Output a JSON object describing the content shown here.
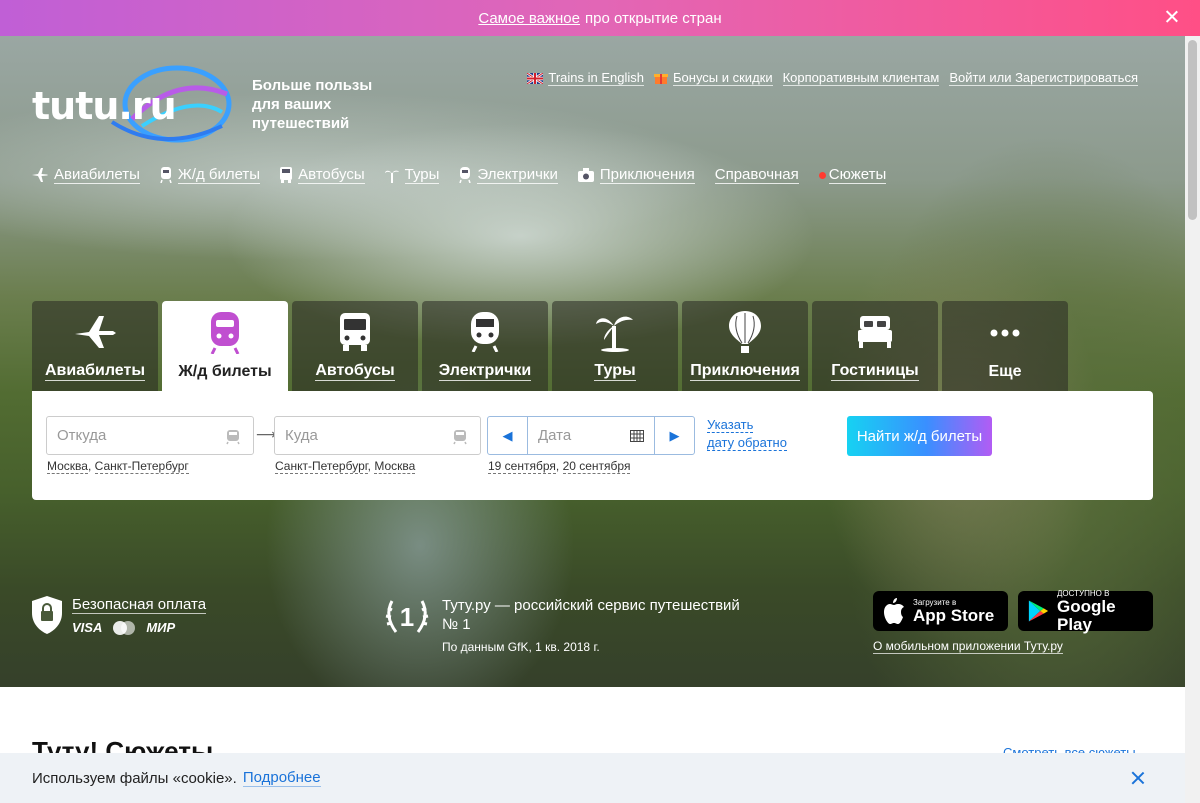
{
  "promo": {
    "link": "Самое важное",
    "text": "про открытие стран"
  },
  "logo": {
    "text": "tutu.ru"
  },
  "tagline": "Больше пользы для ваших путешествий",
  "toplinks": [
    {
      "label": "Trains in English",
      "icon": "uk-flag-icon"
    },
    {
      "label": "Бонусы и скидки",
      "icon": "gift-icon"
    },
    {
      "label": "Корпоративным клиентам"
    },
    {
      "label": "Войти или Зарегистрироваться"
    }
  ],
  "mainnav": [
    {
      "label": "Авиабилеты",
      "icon": "plane-icon"
    },
    {
      "label": "Ж/д билеты",
      "icon": "train-icon"
    },
    {
      "label": "Автобусы",
      "icon": "bus-icon"
    },
    {
      "label": "Туры",
      "icon": "palm-icon"
    },
    {
      "label": "Электрички",
      "icon": "suburban-train-icon"
    },
    {
      "label": "Приключения",
      "icon": "camera-icon"
    },
    {
      "label": "Справочная"
    },
    {
      "label": "Сюжеты",
      "icon": "red-dot-icon"
    }
  ],
  "tabs": [
    {
      "label": "Авиабилеты",
      "icon": "plane-icon"
    },
    {
      "label": "Ж/д билеты",
      "icon": "train-icon",
      "active": true
    },
    {
      "label": "Автобусы",
      "icon": "bus-icon"
    },
    {
      "label": "Электрички",
      "icon": "suburban-train-icon"
    },
    {
      "label": "Туры",
      "icon": "palm-icon"
    },
    {
      "label": "Приключения",
      "icon": "balloon-icon"
    },
    {
      "label": "Гостиницы",
      "icon": "bed-icon"
    },
    {
      "label": "Еще",
      "icon": "more-icon"
    }
  ],
  "search": {
    "from_placeholder": "Откуда",
    "to_placeholder": "Куда",
    "date_placeholder": "Дата",
    "from_hints": [
      "Москва",
      "Санкт-Петербург"
    ],
    "to_hints": [
      "Санкт-Петербург",
      "Москва"
    ],
    "date_hints": [
      "19 сентября",
      "20 сентября"
    ],
    "back_date": "Указать датy обратно",
    "back_date_l1": "Указать",
    "back_date_l2": "дату обратно",
    "find_button": "Найти ж/д билеты"
  },
  "secure": {
    "title": "Безопасная оплата",
    "cards": [
      "VISA",
      "MasterCard",
      "МИР"
    ]
  },
  "award": {
    "line1": "Туту.ру — российский сервис путешествий",
    "line2": "№ 1",
    "source": "По данным GfK, 1 кв. 2018 г.",
    "number": "1"
  },
  "stores": {
    "appstore_small": "Загрузите в",
    "appstore_big": "App Store",
    "gplay_small": "ДОСТУПНО В",
    "gplay_big": "Google Play",
    "link": "О мобильном приложении Туту.ру"
  },
  "section": {
    "title": "Туту! Сюжеты",
    "link": "Смотреть все сюжеты"
  },
  "cookie": {
    "text": "Используем файлы «cookie».",
    "link": "Подробнее"
  },
  "colors": {
    "accent": "#1a73d9",
    "promo_start": "#c05fd6",
    "promo_end": "#ff4f86",
    "tab_active_icon": "#c04fd0"
  }
}
